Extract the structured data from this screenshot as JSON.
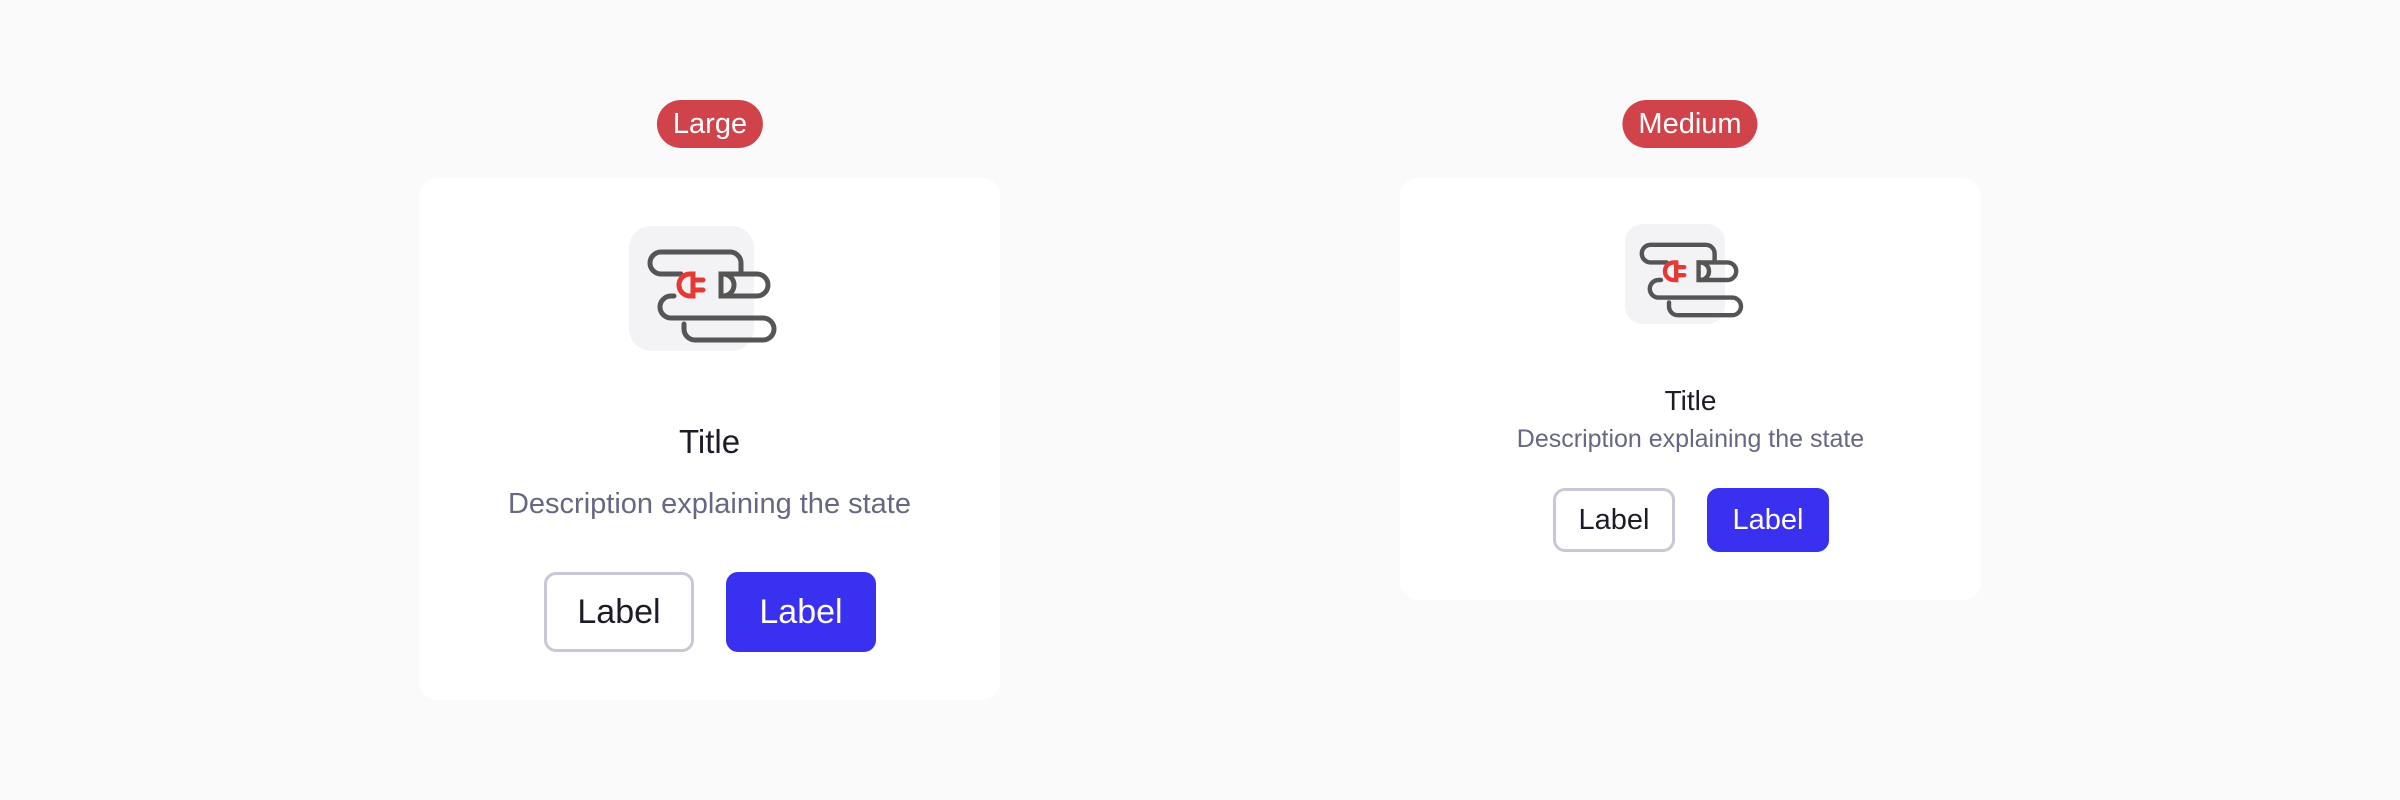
{
  "variants": {
    "large": {
      "badge": "Large",
      "icon": "unplugged-cable-icon",
      "title": "Title",
      "description": "Description explaining the state",
      "secondary_button": "Label",
      "primary_button": "Label"
    },
    "medium": {
      "badge": "Medium",
      "icon": "unplugged-cable-icon",
      "title": "Title",
      "description": "Description explaining the state",
      "secondary_button": "Label",
      "primary_button": "Label"
    }
  },
  "colors": {
    "page_background": "#fafafa",
    "badge_background": "#d1434b",
    "card_background": "#ffffff",
    "primary_button": "#3a31f0",
    "secondary_border": "#c8c8d6",
    "title_text": "#1c1c26",
    "description_text": "#676783",
    "icon_stroke": "#555555",
    "plug_accent": "#e53935"
  }
}
